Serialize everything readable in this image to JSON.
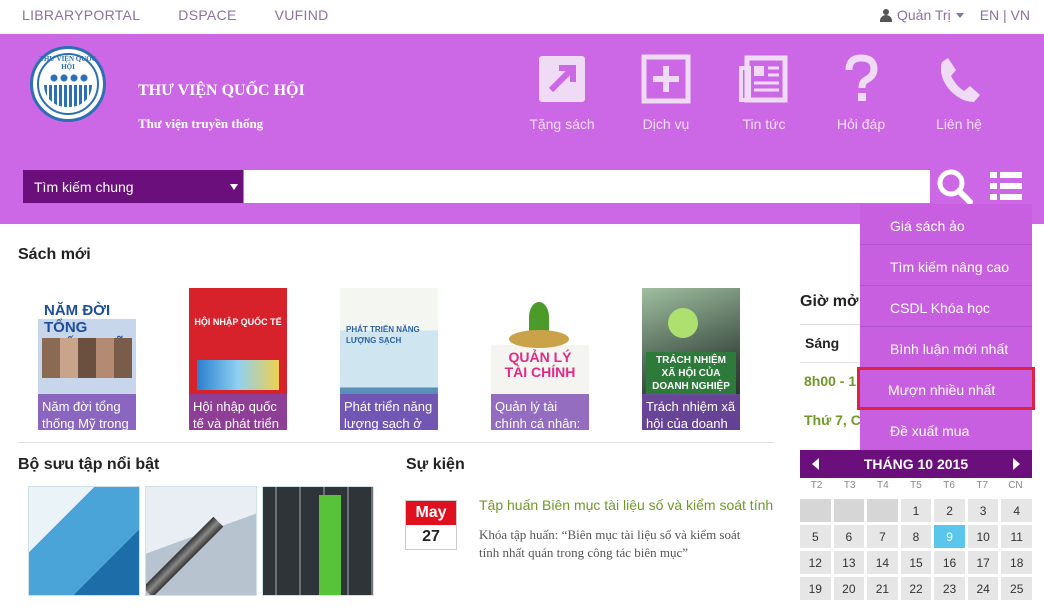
{
  "topbar": {
    "links": [
      "LIBRARYPORTAL",
      "DSPACE",
      "VUFIND"
    ],
    "user": "Quản Trị",
    "lang": "EN | VN"
  },
  "brand": {
    "logo_text": "THƯ VIỆN QUỐC HỘI",
    "title": "THƯ VIỆN QUỐC HỘI",
    "subtitle": "Thư viện truyền thống"
  },
  "nav": [
    {
      "label": "Tặng sách",
      "icon": "donate-book-icon"
    },
    {
      "label": "Dịch vụ",
      "icon": "plus-service-icon"
    },
    {
      "label": "Tin tức",
      "icon": "newspaper-icon"
    },
    {
      "label": "Hỏi đáp",
      "icon": "question-icon"
    },
    {
      "label": "Liên hệ",
      "icon": "phone-icon"
    }
  ],
  "search": {
    "scope": "Tìm kiếm chung",
    "placeholder": ""
  },
  "dropdown": [
    "Giá sách ảo",
    "Tìm kiếm nâng cao",
    "CSDL Khóa học",
    "Bình luận mới nhất",
    "Mượn nhiều nhất",
    "Đề xuất mua"
  ],
  "new_books": {
    "title": "Sách mới",
    "items": [
      {
        "caption": "Năm đời tổng thống Mỹ trong",
        "cover_text": "NĂM ĐỜI TỔNG THỐNG MỸ"
      },
      {
        "caption": "Hội nhập quốc tế và phát triển",
        "cover_text": "HỘI NHẬP QUỐC TẾ"
      },
      {
        "caption": "Phát triển năng lượng sạch ở",
        "cover_text": "PHÁT TRIỂN NĂNG LƯỢNG SẠCH"
      },
      {
        "caption": "Quản lý tài chính cá nhân:",
        "cover_text": "QUẢN LÝ TÀI CHÍNH"
      },
      {
        "caption": "Trách nhiệm xã hội của doanh",
        "cover_text": "TRÁCH NHIỆM XÃ HỘI CỦA DOANH NGHIỆP"
      }
    ]
  },
  "collection": {
    "title": "Bộ sưu tập nổi bật"
  },
  "events": {
    "title": "Sự kiện",
    "month": "May",
    "day": "27",
    "headline": "Tập huấn Biên mục tài liệu số và kiểm soát tính",
    "desc1": "Khóa tập huấn: “Biên mục tài liệu số và kiểm soát",
    "desc2": "tính nhất quán trong công tác biên mục”"
  },
  "hours": {
    "title": "Giờ mở",
    "label": "Sáng",
    "time": "8h00 - 1",
    "days": "Thứ 7, C"
  },
  "calendar": {
    "title": "THÁNG 10 2015",
    "daynames": [
      "T2",
      "T3",
      "T4",
      "T5",
      "T6",
      "T7",
      "CN"
    ],
    "cells": [
      "",
      "",
      "",
      "1",
      "2",
      "3",
      "4",
      "5",
      "6",
      "7",
      "8",
      "9",
      "10",
      "11",
      "12",
      "13",
      "14",
      "15",
      "16",
      "17",
      "18",
      "19",
      "20",
      "21",
      "22",
      "23",
      "24",
      "25"
    ],
    "today": "9"
  }
}
